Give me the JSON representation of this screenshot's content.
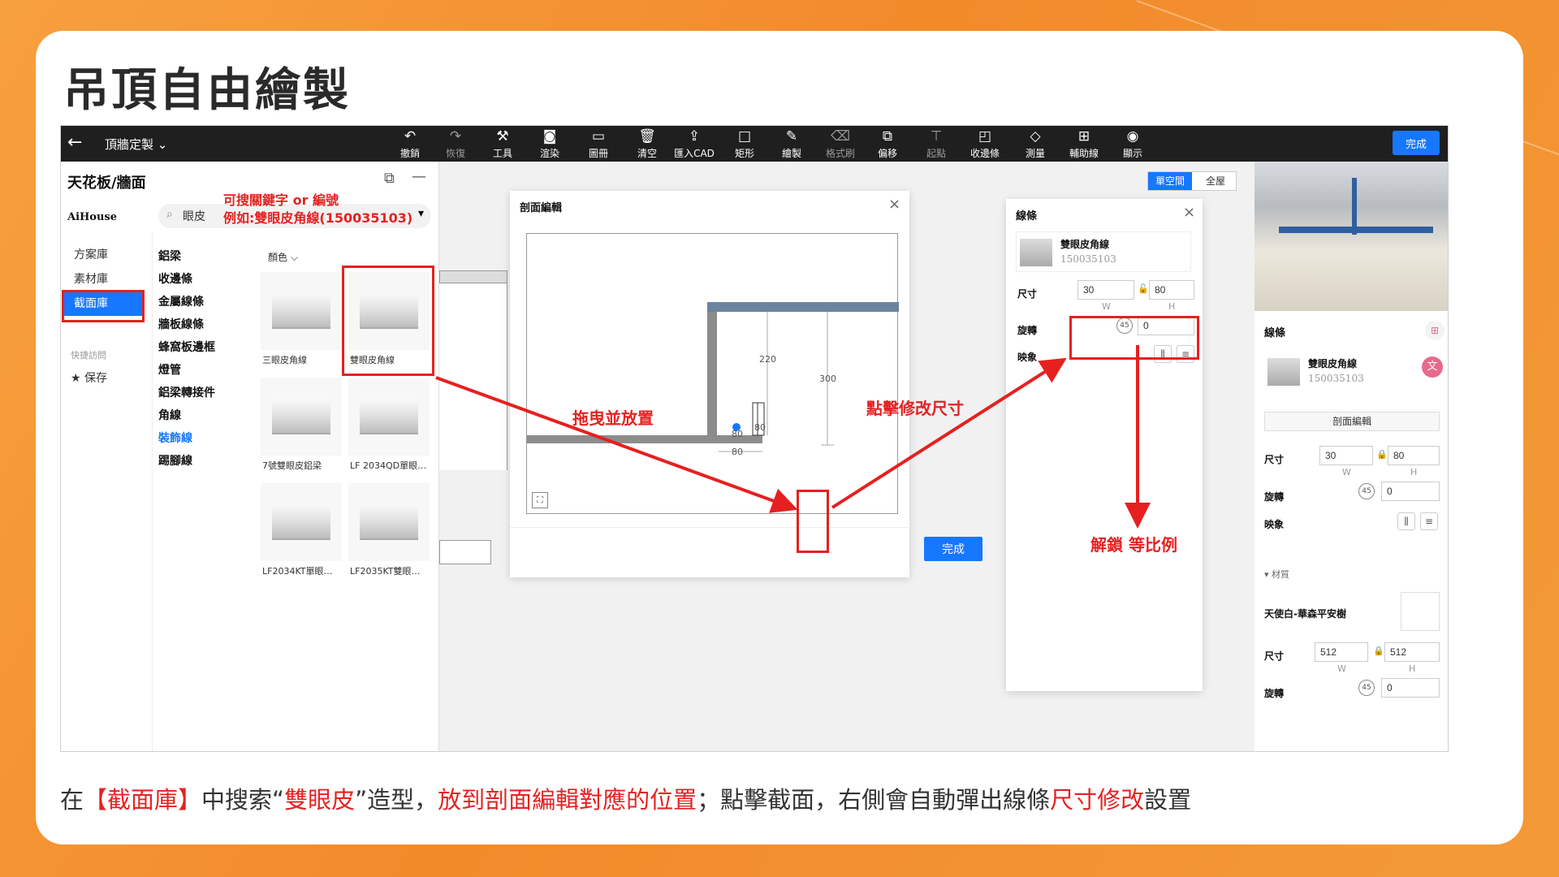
{
  "slide": {
    "title": "吊頂自由繪製",
    "caption": [
      {
        "text": "在",
        "red": false
      },
      {
        "text": "【截面庫】",
        "red": true
      },
      {
        "text": "中搜索“",
        "red": false
      },
      {
        "text": "雙眼皮",
        "red": true
      },
      {
        "text": "”造型，",
        "red": false
      },
      {
        "text": "放到剖面編輯對應的位置",
        "red": true
      },
      {
        "text": "；點擊截面，右側會自動彈出線條",
        "red": false
      },
      {
        "text": "尺寸修改",
        "red": true
      },
      {
        "text": "設置",
        "red": false
      }
    ]
  },
  "topbar": {
    "back": "←",
    "project": "頂牆定製 ⌄",
    "tools": [
      {
        "label": "撤銷",
        "icon": "↶",
        "dim": false
      },
      {
        "label": "恢復",
        "icon": "↷",
        "dim": true
      },
      {
        "label": "工具",
        "icon": "⚒",
        "dim": false
      },
      {
        "label": "渲染",
        "icon": "◙",
        "dim": false
      },
      {
        "label": "圖冊",
        "icon": "▭",
        "dim": false
      },
      {
        "label": "清空",
        "icon": "🗑",
        "dim": false
      },
      {
        "label": "匯入CAD",
        "icon": "⇪",
        "dim": false
      },
      {
        "label": "矩形",
        "icon": "□",
        "dim": false
      },
      {
        "label": "繪製",
        "icon": "✎",
        "dim": false
      },
      {
        "label": "格式刷",
        "icon": "⌫",
        "dim": true
      },
      {
        "label": "偏移",
        "icon": "⧉",
        "dim": false
      },
      {
        "label": "起點",
        "icon": "⊤",
        "dim": true
      },
      {
        "label": "收邊條",
        "icon": "◰",
        "dim": false
      },
      {
        "label": "測量",
        "icon": "◇",
        "dim": false
      },
      {
        "label": "輔助線",
        "icon": "⊞",
        "dim": false
      },
      {
        "label": "顯示",
        "icon": "◉",
        "dim": false
      }
    ],
    "done": "完成"
  },
  "left_panel": {
    "title": "天花板/牆面",
    "brand": "AiHouse",
    "search_value": "眼皮",
    "nav": [
      "方案庫",
      "素材庫",
      "截面庫"
    ],
    "nav_active": 2,
    "quick_access": "快捷訪問",
    "save": "★ 保存",
    "categories": [
      "鋁梁",
      "收邊條",
      "金屬線條",
      "牆板線條",
      "蜂窩板邊框",
      "燈管",
      "鋁梁轉接件",
      "角線",
      "裝飾線",
      "踢腳線"
    ],
    "category_active": 8,
    "filter": "顏色 ⌵",
    "items": [
      "三眼皮角線",
      "雙眼皮角線",
      "7號雙眼皮鋁梁",
      "LF 2034QD單眼…",
      "LF2034KT單眼…",
      "LF2035KT雙眼…"
    ]
  },
  "view_toggle": [
    "單空間",
    "全屋"
  ],
  "section_dialog": {
    "title": "剖面編輯",
    "close": "×",
    "dims": [
      "220",
      "300",
      "80",
      "80",
      "80"
    ],
    "done": "完成"
  },
  "line_dialog": {
    "title": "線條",
    "close": "×",
    "item_name": "雙眼皮角線",
    "item_code": "150035103",
    "size_label": "尺寸",
    "w": "30",
    "h": "80",
    "w_label": "W",
    "h_label": "H",
    "rotate_label": "旋轉",
    "rotate": "0",
    "mirror_label": "映象"
  },
  "right_panel": {
    "title": "線條",
    "item_name": "雙眼皮角線",
    "item_code": "150035103",
    "section_edit": "剖面編輯",
    "size_label": "尺寸",
    "w": "30",
    "h": "80",
    "w_label": "W",
    "h_label": "H",
    "rotate_label": "旋轉",
    "rotate": "0",
    "mirror_label": "映象",
    "material_header": "▾ 材質",
    "material_name": "天使白-華森平安樹",
    "mat_size_label": "尺寸",
    "mat_w": "512",
    "mat_h": "512",
    "mat_w_label": "W",
    "mat_h_label": "H",
    "mat_rotate_label": "旋轉",
    "mat_rotate": "0"
  },
  "annotations": {
    "search_hint_1": "可搜關鍵字 or 編號",
    "search_hint_2": "例如:雙眼皮角線(150035103)",
    "drag": "拖曳並放置",
    "click_resize": "點擊修改尺寸",
    "unlock": "解鎖 等比例"
  },
  "colors": {
    "accent": "#1677ff",
    "annotation": "#e52222",
    "background": "#f39a38"
  }
}
